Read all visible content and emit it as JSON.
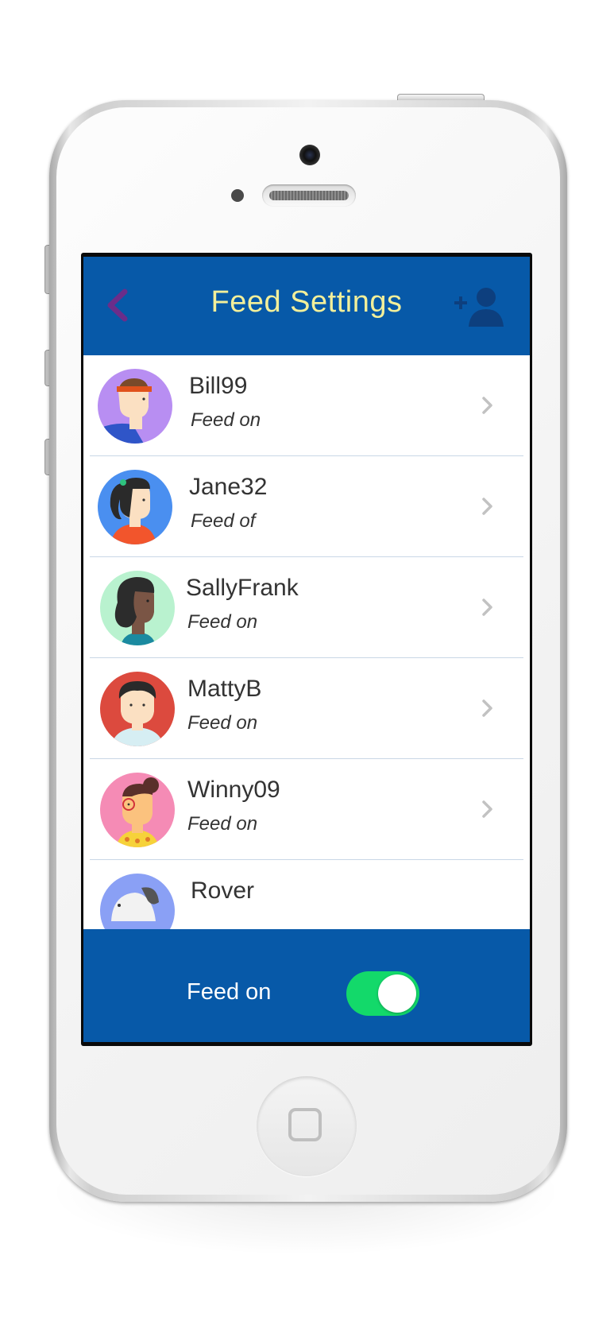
{
  "header": {
    "title": "Feed Settings",
    "back_icon": "chevron-left-icon",
    "add_user_icon": "add-user-icon",
    "title_color": "#f2ef9a",
    "bar_color": "#0759a8",
    "back_color": "#6b2d8a",
    "add_user_color": "#0d3f7e"
  },
  "contacts": [
    {
      "name": "Bill99",
      "status": "Feed on",
      "avatar_bg": "#b88ef2"
    },
    {
      "name": "Jane32",
      "status": "Feed of",
      "avatar_bg": "#4a8ff0"
    },
    {
      "name": "SallyFrank",
      "status": "Feed on",
      "avatar_bg": "#b9f2cf"
    },
    {
      "name": "MattyB",
      "status": "Feed on",
      "avatar_bg": "#dc4a3e"
    },
    {
      "name": "Winny09",
      "status": "Feed on",
      "avatar_bg": "#f58bb5"
    },
    {
      "name": "Rover",
      "status": "",
      "avatar_bg": "#8aa0f5"
    }
  ],
  "footer": {
    "label": "Feed on",
    "toggle_on": true,
    "toggle_color": "#13d96a"
  },
  "device": {
    "home_icon": "home-button-icon"
  }
}
